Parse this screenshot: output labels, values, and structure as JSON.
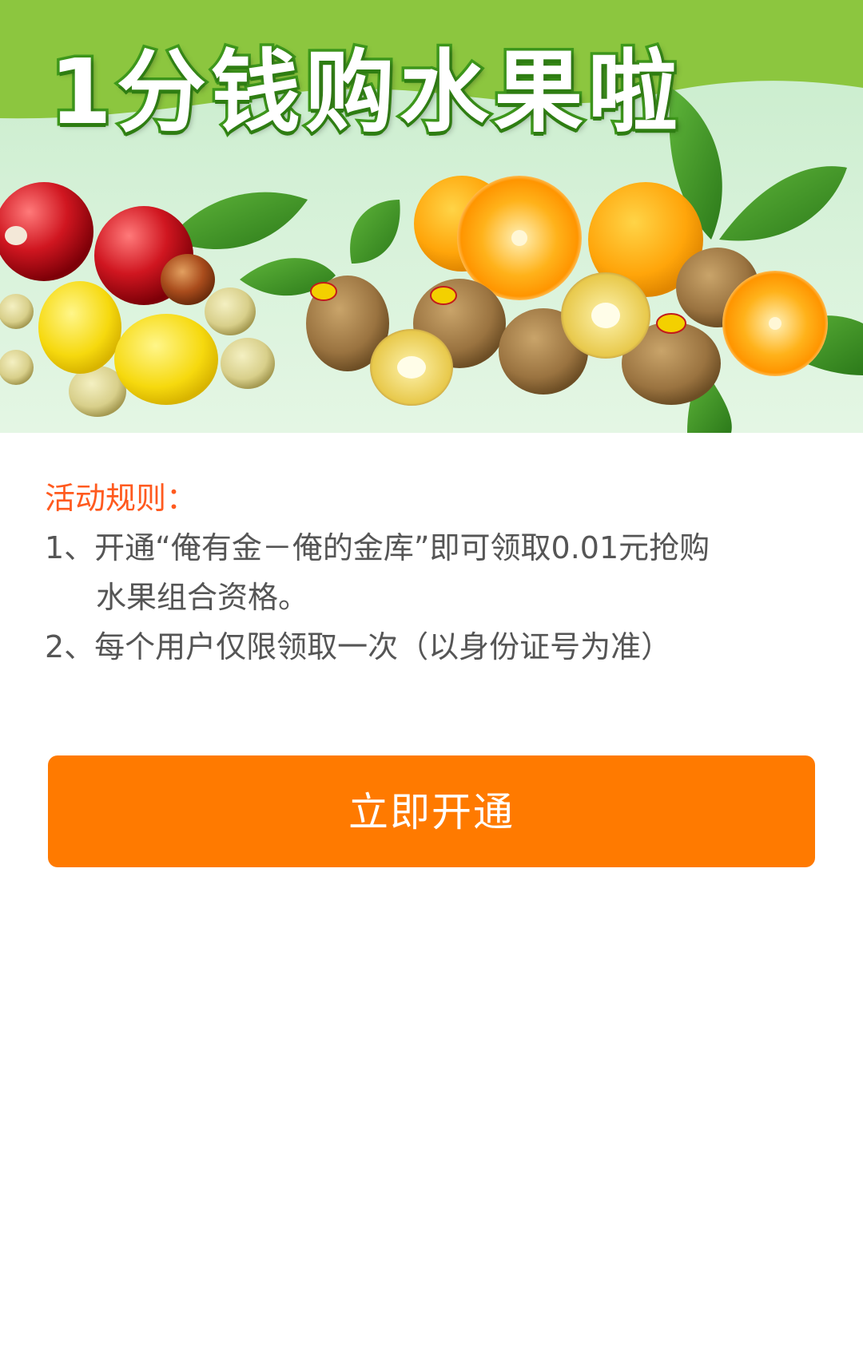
{
  "banner": {
    "title": "1分钱购水果啦",
    "colors": {
      "top_band": "#8cc63f",
      "title_outline": "#3f9b1c"
    },
    "illustration": "fruit-arrangement-image"
  },
  "rules": {
    "heading": "活动规则：",
    "items": [
      "1、开通“俺有金－俺的金库”即可领取0.01元抢购",
      "水果组合资格。",
      "2、每个用户仅限领取一次（以身份证号为准）"
    ]
  },
  "cta": {
    "label": "立即开通",
    "color": "#ff7a00"
  }
}
